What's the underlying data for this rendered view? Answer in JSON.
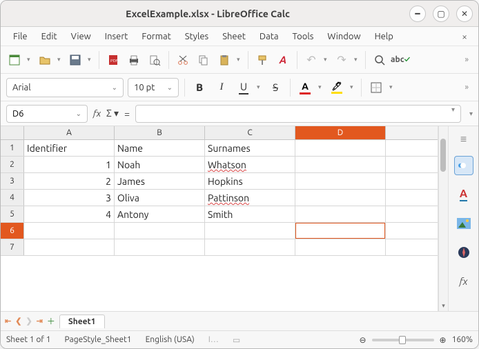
{
  "window": {
    "title": "ExcelExample.xlsx - LibreOffice Calc"
  },
  "menu": {
    "items": [
      "File",
      "Edit",
      "View",
      "Insert",
      "Format",
      "Styles",
      "Sheet",
      "Data",
      "Tools",
      "Window",
      "Help"
    ]
  },
  "format": {
    "font": "Arial",
    "size": "10 pt"
  },
  "namebox": "D6",
  "colwidths": {
    "A": 131,
    "B": 131,
    "C": 131,
    "D": 131
  },
  "chart_data": {
    "type": "table",
    "columns": [
      "A",
      "B",
      "C",
      "D"
    ],
    "headers_row": 1,
    "data": [
      {
        "row": 1,
        "A": "Identifier",
        "B": "Name",
        "C": "Surnames",
        "D": ""
      },
      {
        "row": 2,
        "A": 1,
        "B": "Noah",
        "C": "Whatson",
        "D": ""
      },
      {
        "row": 3,
        "A": 2,
        "B": "James",
        "C": "Hopkins",
        "D": ""
      },
      {
        "row": 4,
        "A": 3,
        "B": "Oliva",
        "C": "Pattinson",
        "D": ""
      },
      {
        "row": 5,
        "A": 4,
        "B": "Antony",
        "C": "Smith",
        "D": ""
      },
      {
        "row": 6,
        "A": "",
        "B": "",
        "C": "",
        "D": ""
      },
      {
        "row": 7,
        "A": "",
        "B": "",
        "C": "",
        "D": ""
      }
    ],
    "spellcheck_flags": {
      "2C": true,
      "4C": true
    },
    "active_cell": "D6",
    "selected_column": "D",
    "selected_row": 6
  },
  "tabs": {
    "active": "Sheet1"
  },
  "status": {
    "sheet": "Sheet 1 of 1",
    "pagestyle": "PageStyle_Sheet1",
    "lang": "English (USA)",
    "zoom": "160%"
  }
}
